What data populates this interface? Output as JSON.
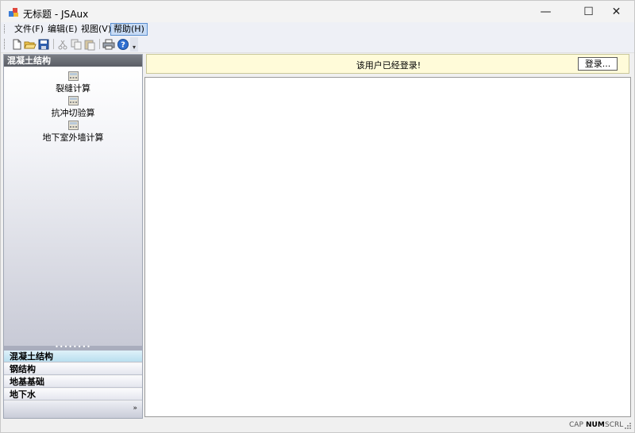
{
  "window": {
    "title": "无标题 - JSAux",
    "minimize": "—",
    "maximize": "☐",
    "close": "✕"
  },
  "menu": [
    {
      "label": "文件(F)"
    },
    {
      "label": "编辑(E)"
    },
    {
      "label": "视图(V)"
    },
    {
      "label": "帮助(H)"
    }
  ],
  "toolbar": {
    "buttons": [
      "new-icon",
      "open-icon",
      "save-icon",
      "cut-icon",
      "copy-icon",
      "paste-icon",
      "print-icon",
      "help-icon"
    ],
    "overflow": "▾"
  },
  "sidebar": {
    "header": "混凝土结构",
    "tools": [
      {
        "label": "裂缝计算"
      },
      {
        "label": "抗冲切验算"
      },
      {
        "label": "地下室外墙计算"
      }
    ],
    "splitter": "••••••••",
    "categories": [
      {
        "label": "混凝土结构"
      },
      {
        "label": "钢结构"
      },
      {
        "label": "地基基础"
      },
      {
        "label": "地下水"
      }
    ],
    "more": "»"
  },
  "login": {
    "message": "该用户已经登录!",
    "button": "登录..."
  },
  "status": {
    "cap": "CAP",
    "num": "NUM",
    "scrl": "SCRL"
  },
  "colors": {
    "menu_active": "#c7dbf5",
    "info_bar": "#fffbd9",
    "category_selected": "#b9dfef"
  }
}
